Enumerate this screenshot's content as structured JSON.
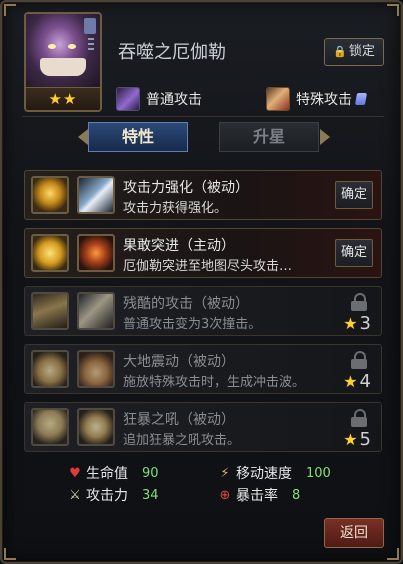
{
  "hero": {
    "name": "吞噬之厄伽勒",
    "stars": "★★"
  },
  "header": {
    "lock_button": "锁定"
  },
  "attacks": {
    "normal": "普通攻击",
    "special": "特殊攻击"
  },
  "tabs": {
    "traits": "特性",
    "upgrade": "升星"
  },
  "skills": [
    {
      "name": "攻击力强化（被动）",
      "desc": "攻击力获得强化。",
      "action": "确定",
      "locked": false
    },
    {
      "name": "果敢突进（主动）",
      "desc": "厄伽勒突进至地图尽头攻击…",
      "action": "确定",
      "locked": false
    },
    {
      "name": "残酷的攻击（被动）",
      "desc": "普通攻击变为3次撞击。",
      "required_stars": "3",
      "locked": true
    },
    {
      "name": "大地震动（被动）",
      "desc": "施放特殊攻击时，生成冲击波。",
      "required_stars": "4",
      "locked": true
    },
    {
      "name": "狂暴之吼（被动）",
      "desc": "追加狂暴之吼攻击。",
      "required_stars": "5",
      "locked": true
    }
  ],
  "stats": {
    "hp": {
      "label": "生命值",
      "value": "90"
    },
    "move_speed": {
      "label": "移动速度",
      "value": "100"
    },
    "attack": {
      "label": "攻击力",
      "value": "34"
    },
    "crit": {
      "label": "暴击率",
      "value": "8"
    }
  },
  "footer": {
    "back_button": "返回"
  },
  "colors": {
    "accent_gold": "#ffcf2e",
    "stat_value": "#7fe07a",
    "tab_active": "#2c4a78"
  }
}
